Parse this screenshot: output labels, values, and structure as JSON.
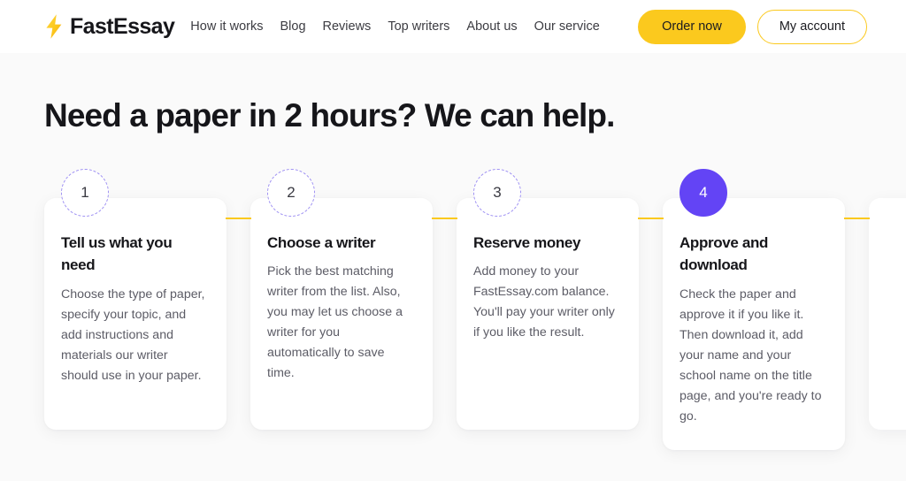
{
  "header": {
    "brand": {
      "icon": "lightning-bolt-icon",
      "name": "FastEssay"
    },
    "nav": [
      {
        "label": "How it works"
      },
      {
        "label": "Blog"
      },
      {
        "label": "Reviews"
      },
      {
        "label": "Top writers"
      },
      {
        "label": "About us"
      },
      {
        "label": "Our service"
      }
    ],
    "actions": {
      "order_now": "Order now",
      "my_account": "My account"
    }
  },
  "main": {
    "title": "Need a paper in 2 hours? We can help.",
    "steps": [
      {
        "number": "1",
        "title": "Tell us what you need",
        "text": "Choose the type of paper, specify your topic, and add instructions and materials our writer should use in your paper.",
        "active": false
      },
      {
        "number": "2",
        "title": "Choose a writer",
        "text": "Pick the best matching writer from the list. Also, you may let us choose a writer for you automatically to save time.",
        "active": false
      },
      {
        "number": "3",
        "title": "Reserve money",
        "text": "Add money to your FastEssay.com balance. You'll pay your writer only if you like the result.",
        "active": false
      },
      {
        "number": "4",
        "title": "Approve and download",
        "text": "Check the paper and approve it if you like it. Then download it, add your name and your school name on the title page, and you're ready to go.",
        "active": true
      }
    ]
  },
  "colors": {
    "accent_yellow": "#fbc91e",
    "accent_purple": "#6344f5",
    "badge_dashed_purple": "#9f91f3",
    "page_background": "#fafafa",
    "card_background": "#ffffff",
    "text_primary": "#16161a",
    "text_secondary": "#5c5c66"
  }
}
